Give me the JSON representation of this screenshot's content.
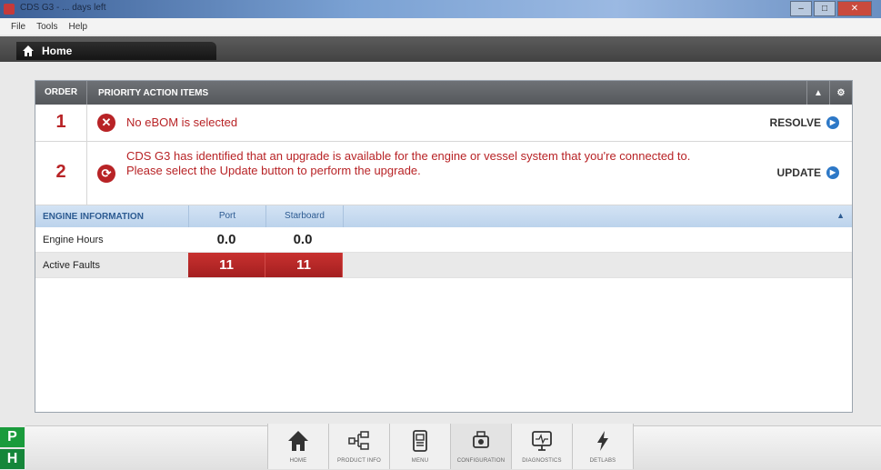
{
  "window": {
    "title": "CDS G3 - ... days left",
    "min": "–",
    "max": "□",
    "close": "✕"
  },
  "menu": [
    "File",
    "Tools",
    "Help"
  ],
  "header": {
    "home_label": "Home"
  },
  "priority": {
    "order_label": "ORDER",
    "title": "PRIORITY ACTION ITEMS",
    "items": [
      {
        "num": "1",
        "icon": "error-icon",
        "message": "No eBOM is selected",
        "action": "RESOLVE"
      },
      {
        "num": "2",
        "icon": "update-icon",
        "message": "CDS G3 has identified that an upgrade is available for the engine or vessel system that you're connected to.",
        "message2": "Please select the Update button to perform the upgrade.",
        "action": "UPDATE"
      }
    ]
  },
  "engine": {
    "title": "ENGINE INFORMATION",
    "col_port": "Port",
    "col_starboard": "Starboard",
    "rows": [
      {
        "label": "Engine Hours",
        "port": "0.0",
        "starboard": "0.0"
      },
      {
        "label": "Active Faults",
        "port": "11",
        "starboard": "11"
      }
    ]
  },
  "side": {
    "p": "P",
    "h": "H"
  },
  "nav": [
    "HOME",
    "PRODUCT INFO",
    "MENU",
    "CONFIGURATION",
    "DIAGNOSTICS",
    "DETLABS"
  ],
  "colors": {
    "accent_red": "#b82326",
    "accent_blue": "#2d78c7",
    "green": "#1a9b3c"
  }
}
